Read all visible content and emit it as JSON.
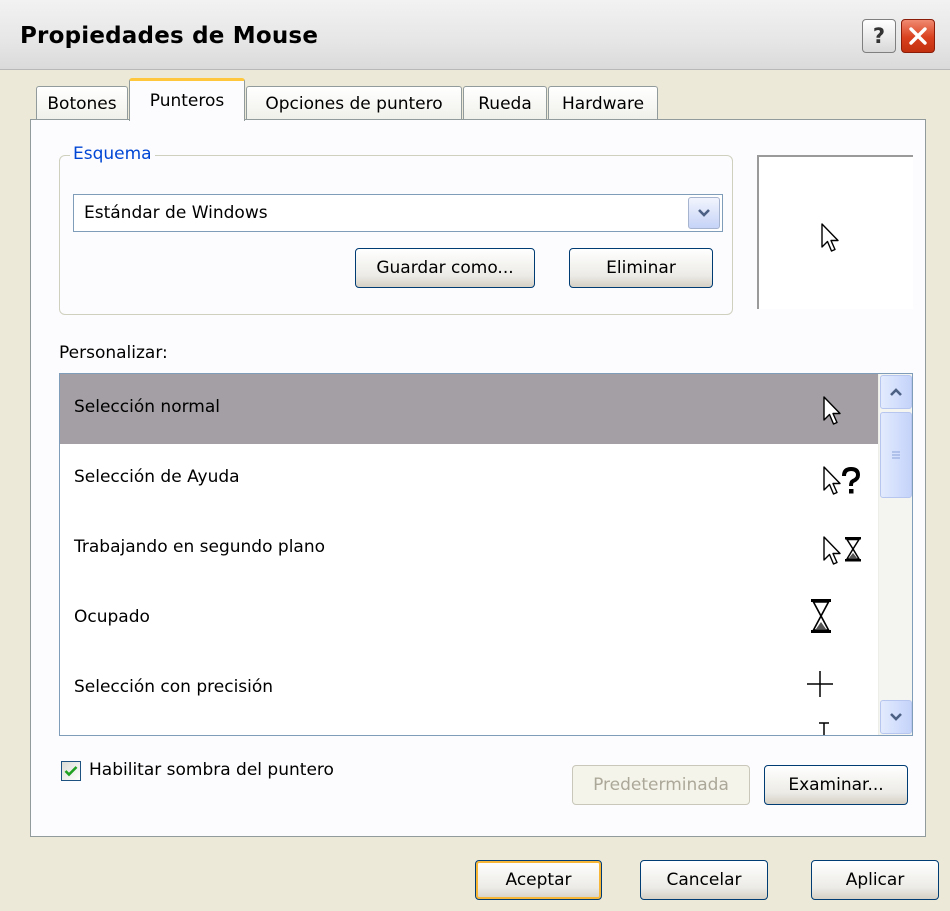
{
  "window": {
    "title": "Propiedades de Mouse",
    "help_glyph": "?",
    "accent_color": "#0046d5"
  },
  "tabs": [
    {
      "label": "Botones",
      "active": false
    },
    {
      "label": "Punteros",
      "active": true
    },
    {
      "label": "Opciones de puntero",
      "active": false
    },
    {
      "label": "Rueda",
      "active": false
    },
    {
      "label": "Hardware",
      "active": false
    }
  ],
  "scheme": {
    "group_label": "Esquema",
    "selected_value": "Estándar de Windows",
    "save_as_label": "Guardar como...",
    "delete_label": "Eliminar"
  },
  "preview": {
    "icon": "arrow-cursor-icon"
  },
  "customize": {
    "label": "Personalizar:",
    "items": [
      {
        "label": "Selección normal",
        "icon": "arrow-cursor-icon",
        "selected": true
      },
      {
        "label": "Selección de Ayuda",
        "icon": "help-cursor-icon",
        "selected": false
      },
      {
        "label": "Trabajando en segundo plano",
        "icon": "working-cursor-icon",
        "selected": false
      },
      {
        "label": "Ocupado",
        "icon": "hourglass-icon",
        "selected": false
      },
      {
        "label": "Selección con precisión",
        "icon": "crosshair-icon",
        "selected": false
      },
      {
        "label": "",
        "icon": "text-select-icon",
        "selected": false
      }
    ]
  },
  "shadow": {
    "label": "Habilitar sombra del puntero",
    "checked": true
  },
  "buttons": {
    "default_label": "Predeterminada",
    "browse_label": "Examinar...",
    "ok_label": "Aceptar",
    "cancel_label": "Cancelar",
    "apply_label": "Aplicar"
  }
}
